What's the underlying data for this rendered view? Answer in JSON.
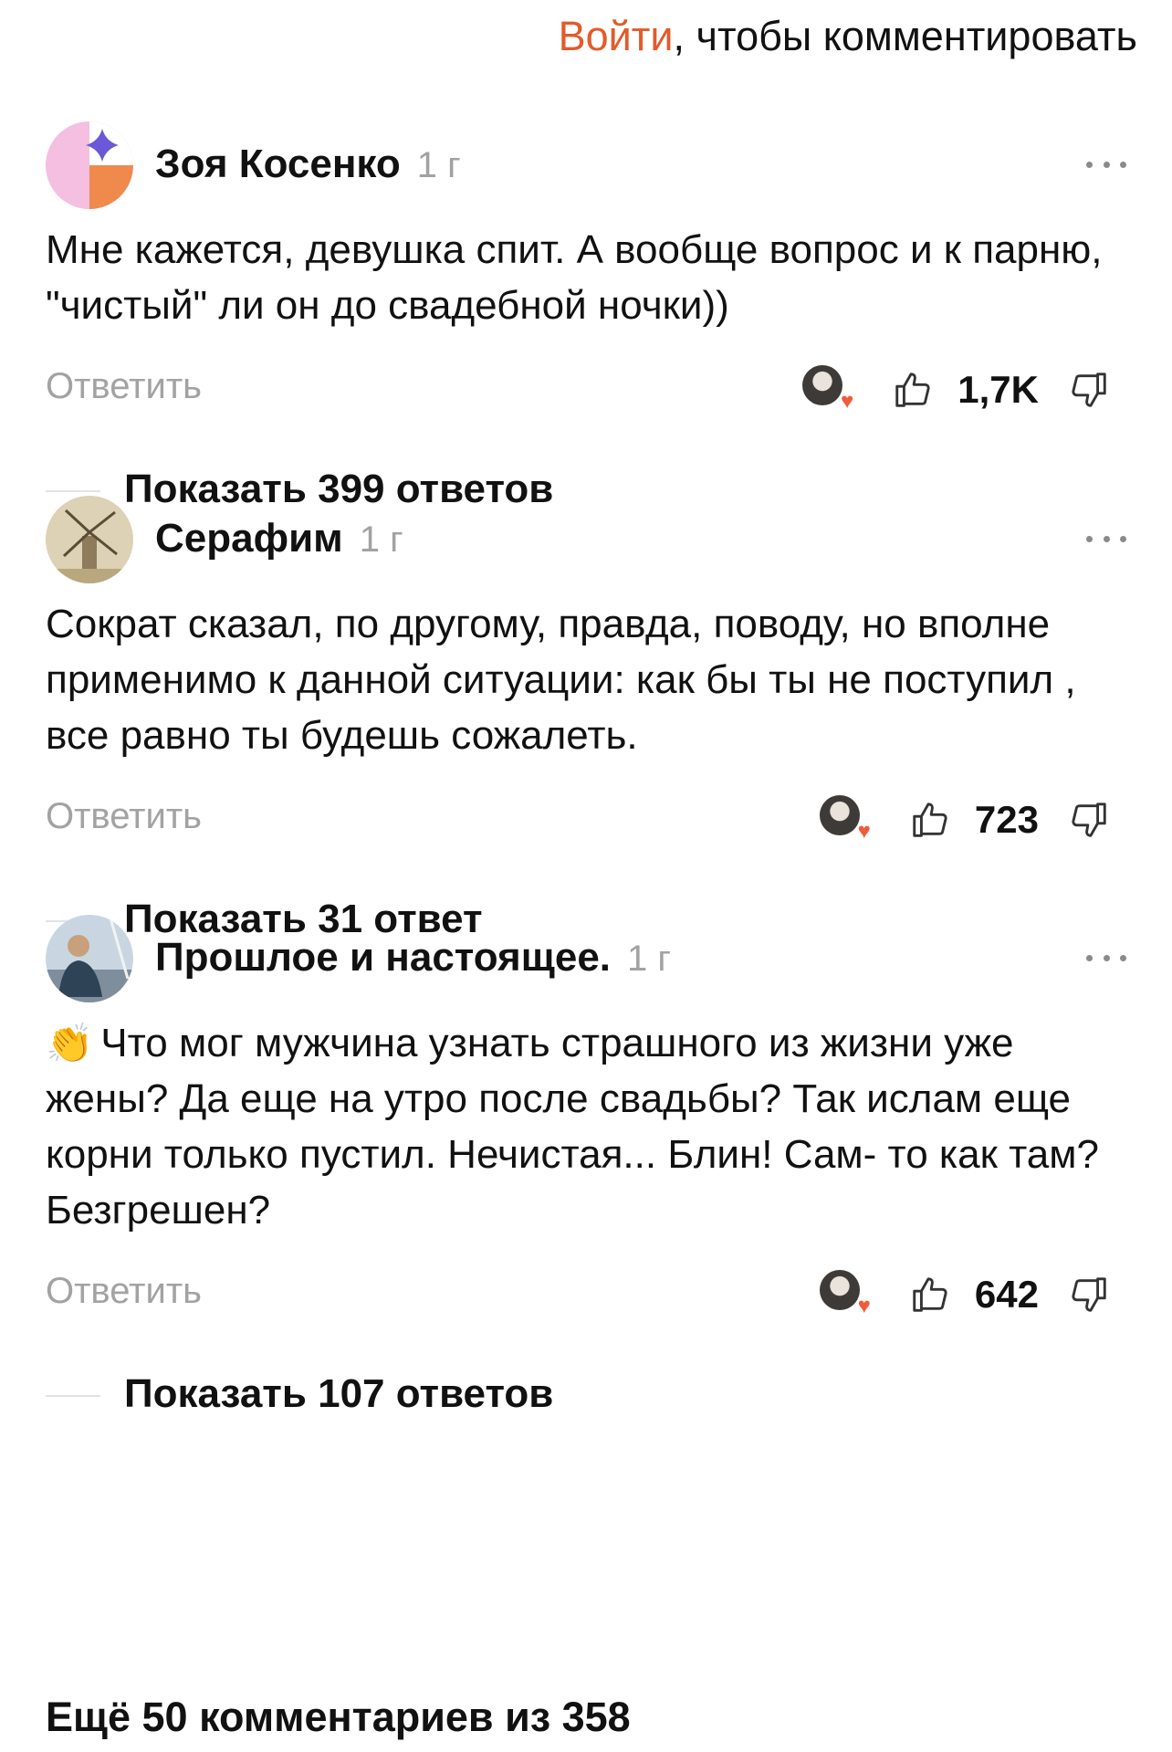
{
  "login": {
    "link": "Войти",
    "suffix": ", чтобы комментировать"
  },
  "comments": [
    {
      "author": "Зоя Косенко",
      "age": "1 г",
      "text": "Мне кажется, девушка спит. А вообще вопрос и к парню, \"чистый\" ли он до свадебной ночки))",
      "reply": "Ответить",
      "likes": "1,7K",
      "replies": "Показать 399 ответов",
      "avatar": "gradient-avatar"
    },
    {
      "author": "Серафим",
      "age": "1 г",
      "text": "Сократ сказал, по другому, правда, поводу, но вполне применимо к данной ситуации: как бы ты не поступил , все равно ты будешь сожалеть.",
      "reply": "Ответить",
      "likes": "723",
      "replies": "Показать 31 ответ",
      "avatar": "windmill-avatar"
    },
    {
      "author": "Прошлое и настоящее.",
      "age": "1 г",
      "emoji": "👏",
      "text": "Что мог мужчина узнать страшного из жизни уже жены? Да еще на утро после свадьбы? Так ислам еще корни только пустил. Нечистая... Блин! Сам- то как там? Безгрешен?",
      "reply": "Ответить",
      "likes": "642",
      "replies": "Показать 107 ответов",
      "avatar": "photo-avatar"
    }
  ],
  "more_comments": "Ещё 50 комментариев из 358",
  "colors": {
    "accent": "#e25b2a",
    "muted": "#a2a2a2",
    "text": "#111111"
  },
  "icons": [
    "more-icon",
    "thumbs-up-icon",
    "thumbs-down-icon",
    "heart-icon"
  ]
}
